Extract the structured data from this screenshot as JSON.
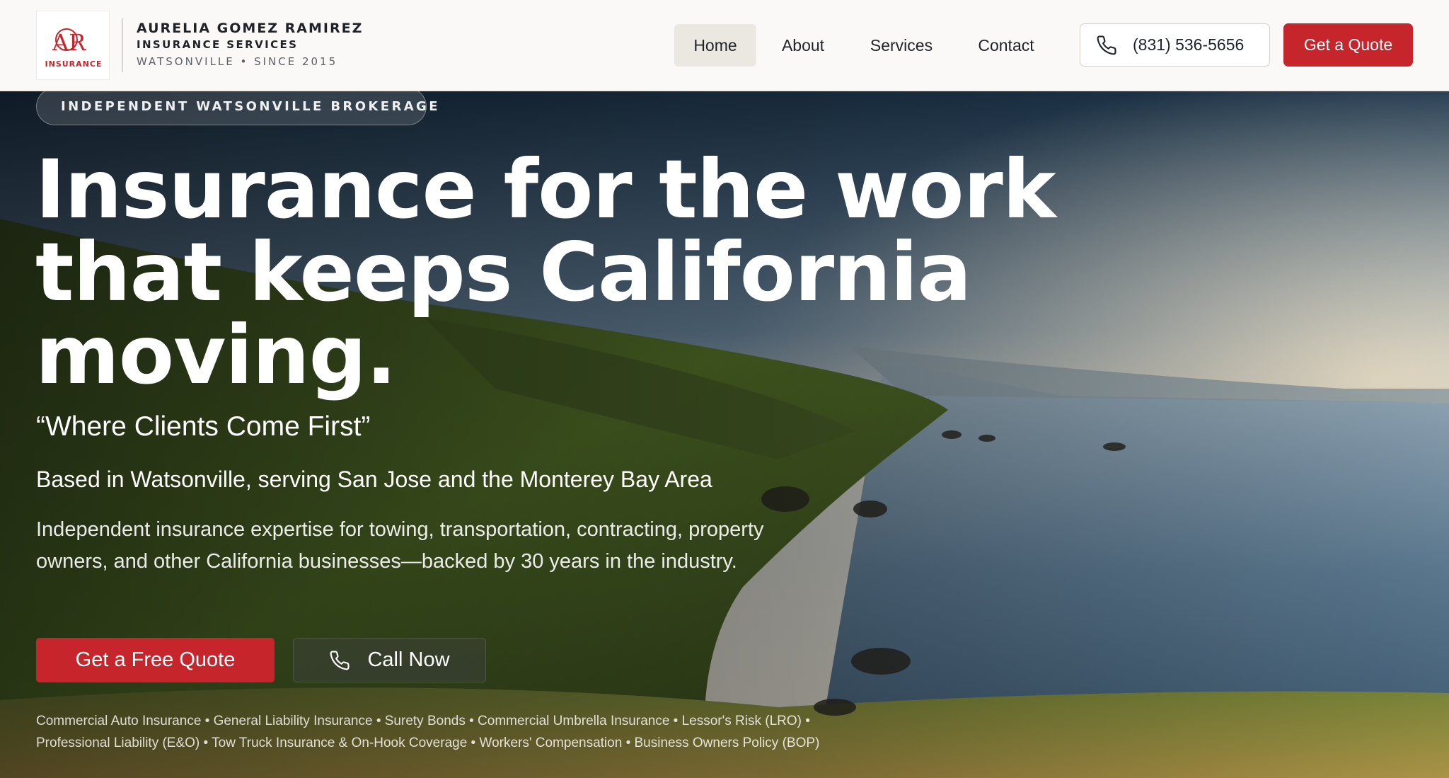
{
  "header": {
    "logo": {
      "monogram": "AR",
      "caption": "INSURANCE",
      "accent": "#c6262b"
    },
    "brand_name": "AURELIA GOMEZ RAMIREZ",
    "brand_sub": "INSURANCE SERVICES",
    "brand_meta": "WATSONVILLE • SINCE 2015",
    "nav": {
      "home": "Home",
      "about": "About",
      "services": "Services",
      "contact": "Contact",
      "active": "Home"
    },
    "phone": {
      "label": "(831) 536-5656",
      "icon": "phone-icon"
    },
    "quote_button": "Get a Quote"
  },
  "hero": {
    "badge": "INDEPENDENT WATSONVILLE BROKERAGE",
    "headline": {
      "line1": "Insurance for the work",
      "line2": "that keeps California",
      "line3": "moving."
    },
    "tagline": "“Where Clients Come First”",
    "subheading": "Based in Watsonville, serving San Jose and the Monterey Bay Area",
    "description": "Independent insurance expertise for towing, transportation, contracting, property owners, and other California businesses—backed by 30 years in the industry.",
    "cta_quote": "Get a Free Quote",
    "cta_call": "Call Now",
    "services_line1": "Commercial Auto Insurance • General Liability Insurance • Surety Bonds • Commercial Umbrella Insurance • Lessor's Risk (LRO) •",
    "services_line2": "Professional Liability (E&O) • Tow Truck Insurance & On-Hook Coverage • Workers' Compensation • Business Owners Policy (BOP)"
  },
  "colors": {
    "brand_red": "#c6262b",
    "header_bg": "#faf9f7",
    "nav_active_bg": "#ebe8e2",
    "text_dark": "#1f2328"
  }
}
